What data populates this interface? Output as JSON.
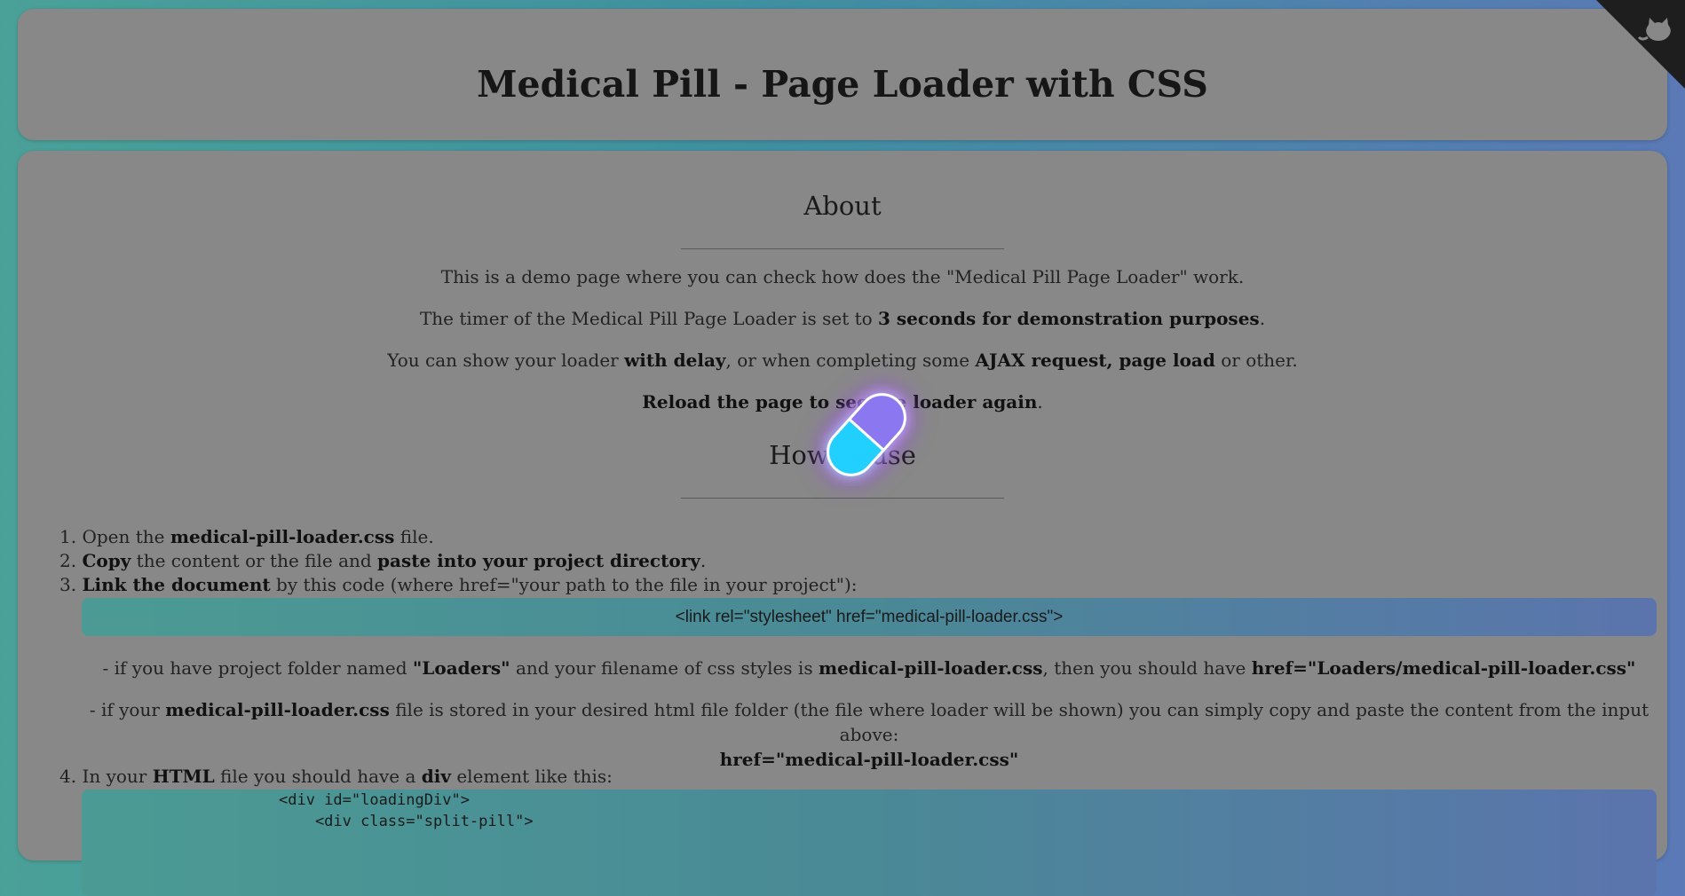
{
  "header": {
    "title": "Medical Pill - Page Loader with CSS"
  },
  "about": {
    "title": "About",
    "line1": "This is a demo page where you can check how does the \"Medical Pill Page Loader\" work.",
    "line2_pre": "The timer of the Medical Pill Page Loader is set to ",
    "line2_bold": "3 seconds for demonstration purposes",
    "line2_post": ".",
    "line3_a": "You can show your loader ",
    "line3_b": "with delay",
    "line3_c": ", or when completing some ",
    "line3_d": "AJAX request, page load",
    "line3_e": " or other.",
    "line4_bold": "Reload the page to see the loader again",
    "line4_post": "."
  },
  "howto": {
    "title": "How to use",
    "step1_a": "1. Open the ",
    "step1_b": "medical-pill-loader.css",
    "step1_c": " file.",
    "step2_a": "2. ",
    "step2_b": "Copy",
    "step2_c": " the content or the file and ",
    "step2_d": "paste into your project directory",
    "step2_e": ".",
    "step3_a": "3. ",
    "step3_b": "Link the document",
    "step3_c": " by this code (where href=\"your path to the file in your project\"):",
    "link_code": "<link rel=\"stylesheet\" href=\"medical-pill-loader.css\">",
    "note1_a": "- if you have project folder named ",
    "note1_b": "\"Loaders\"",
    "note1_c": " and your filename of css styles is ",
    "note1_d": "medical-pill-loader.css",
    "note1_e": ", then you should have ",
    "note1_f": "href=\"Loaders/medical-pill-loader.css\"",
    "note2_a": "- if your ",
    "note2_b": "medical-pill-loader.css",
    "note2_c": " file is stored in your desired html file folder (the file where loader will be shown) you can simply copy and paste the content from the input above:",
    "note2_d": "href=\"medical-pill-loader.css\"",
    "step4_a": "4. In your ",
    "step4_b": "HTML",
    "step4_c": " file you should have a ",
    "step4_d": "div",
    "step4_e": " element like this:",
    "div_code_1": "<div id=\"loadingDiv\">",
    "div_code_2": "    <div class=\"split-pill\">"
  },
  "colors": {
    "pill_top": "#8b78f0",
    "pill_bottom": "#22d0ff",
    "glow": "#a042ff"
  },
  "icons": {
    "corner": "github-octocat-icon"
  }
}
